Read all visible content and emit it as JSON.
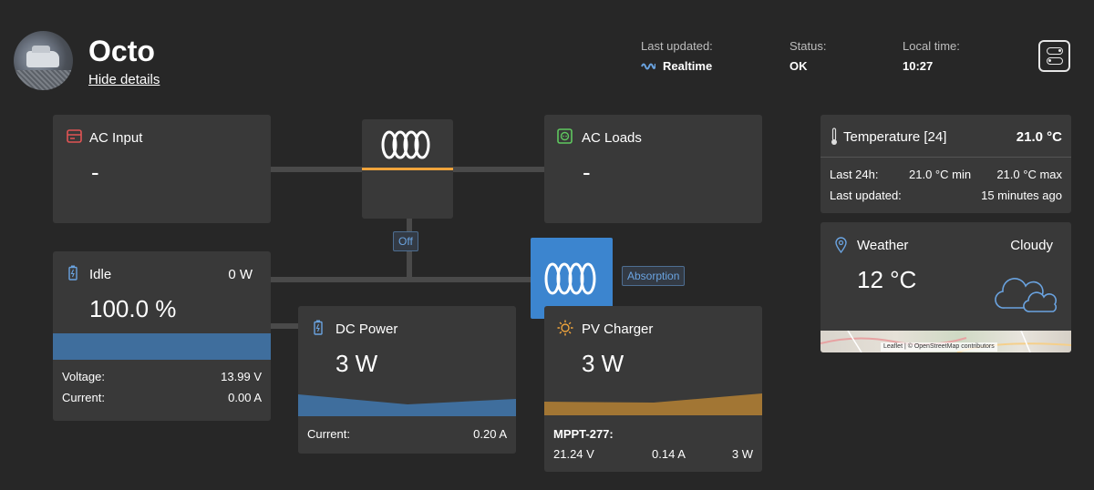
{
  "header": {
    "title": "Octo",
    "hide_details": "Hide details",
    "last_updated_label": "Last updated:",
    "last_updated_value": "Realtime",
    "status_label": "Status:",
    "status_value": "OK",
    "local_time_label": "Local time:",
    "local_time_value": "10:27"
  },
  "ac_input": {
    "title": "AC Input",
    "value": "-"
  },
  "ac_loads": {
    "title": "AC Loads",
    "value": "-"
  },
  "inverter": {
    "state": "Off"
  },
  "mppt": {
    "state": "Absorption"
  },
  "battery": {
    "title": "Idle",
    "power": "0 W",
    "soc": "100.0 %",
    "soc_fraction": 1.0,
    "voltage_label": "Voltage:",
    "voltage_value": "13.99 V",
    "current_label": "Current:",
    "current_value": "0.00 A"
  },
  "dc_power": {
    "title": "DC Power",
    "value": "3 W",
    "current_label": "Current:",
    "current_value": "0.20 A"
  },
  "pv_charger": {
    "title": "PV Charger",
    "value": "3 W",
    "device": "MPPT-277:",
    "voltage": "21.24 V",
    "current": "0.14 A",
    "power": "3 W"
  },
  "temperature": {
    "title": "Temperature [24]",
    "value": "21.0 °C",
    "last24_label": "Last 24h:",
    "min": "21.0 °C min",
    "max": "21.0 °C max",
    "updated_label": "Last updated:",
    "updated_value": "15 minutes ago"
  },
  "weather": {
    "title": "Weather",
    "condition": "Cloudy",
    "temp": "12 °C",
    "map_attribution": "Leaflet | © OpenStreetMap contributors"
  },
  "colors": {
    "background": "#272727",
    "card": "#393939",
    "accent_blue": "#3c85cf",
    "battery_fill": "#3f6e9d",
    "solar_fill": "#a27634",
    "inverter_bar": "#f0a43c",
    "ac_input_icon": "#e05454",
    "ac_loads_icon": "#5fc75f"
  }
}
